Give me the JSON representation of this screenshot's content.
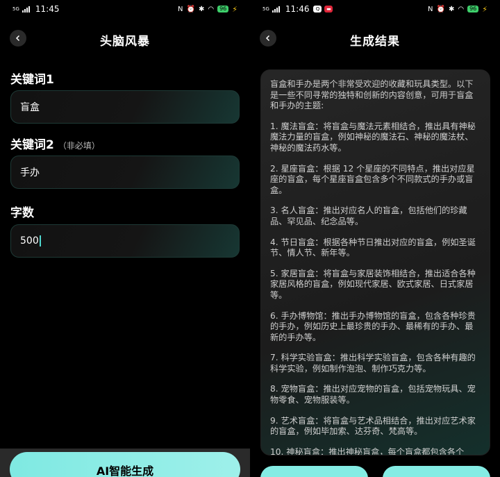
{
  "left": {
    "status": {
      "network": "5G",
      "time": "11:45",
      "battery": "96"
    },
    "title": "头脑风暴",
    "keyword1": {
      "label": "关键词1",
      "value": "盲盒"
    },
    "keyword2": {
      "label": "关键词2",
      "note": "（非必填）",
      "value": "手办"
    },
    "wordcount": {
      "label": "字数",
      "value": "500"
    },
    "generate_label": "AI智能生成"
  },
  "right": {
    "status": {
      "network": "5G",
      "time": "11:46",
      "battery": "96"
    },
    "title": "生成结果",
    "paragraphs": [
      "盲盒和手办是两个非常受欢迎的收藏和玩具类型。以下是一些不同寻常的独特和创新的内容创意，可用于盲盒和手办的主题:",
      "1. 魔法盲盒：将盲盒与魔法元素相结合，推出具有神秘魔法力量的盲盒，例如神秘的魔法石、神秘的魔法杖、神秘的魔法药水等。",
      "2. 星座盲盒：根据 12 个星座的不同特点，推出对应星座的盲盒，每个星座盲盒包含多个不同款式的手办或盲盒。",
      "3. 名人盲盒：推出对应名人的盲盒，包括他们的珍藏品、罕见品、纪念品等。",
      "4. 节日盲盒：根据各种节日推出对应的盲盒，例如圣诞节、情人节、新年等。",
      "5. 家居盲盒：将盲盒与家居装饰相结合，推出适合各种家居风格的盲盒，例如现代家居、欧式家居、日式家居等。",
      "6. 手办博物馆：推出手办博物馆的盲盒，包含各种珍贵的手办，例如历史上最珍贵的手办、最稀有的手办、最新的手办等。",
      "7. 科学实验盲盒：推出科学实验盲盒，包含各种有趣的科学实验，例如制作泡泡、制作巧克力等。",
      "8. 宠物盲盒：推出对应宠物的盲盒，包括宠物玩具、宠物零食、宠物服装等。",
      "9. 艺术盲盒：将盲盒与艺术品相结合，推出对应艺术家的盲盒，例如毕加索、达芬奇、梵高等。",
      "10. 神秘盲盒：推出神秘盲盒，每个盲盒都包含各个"
    ]
  }
}
